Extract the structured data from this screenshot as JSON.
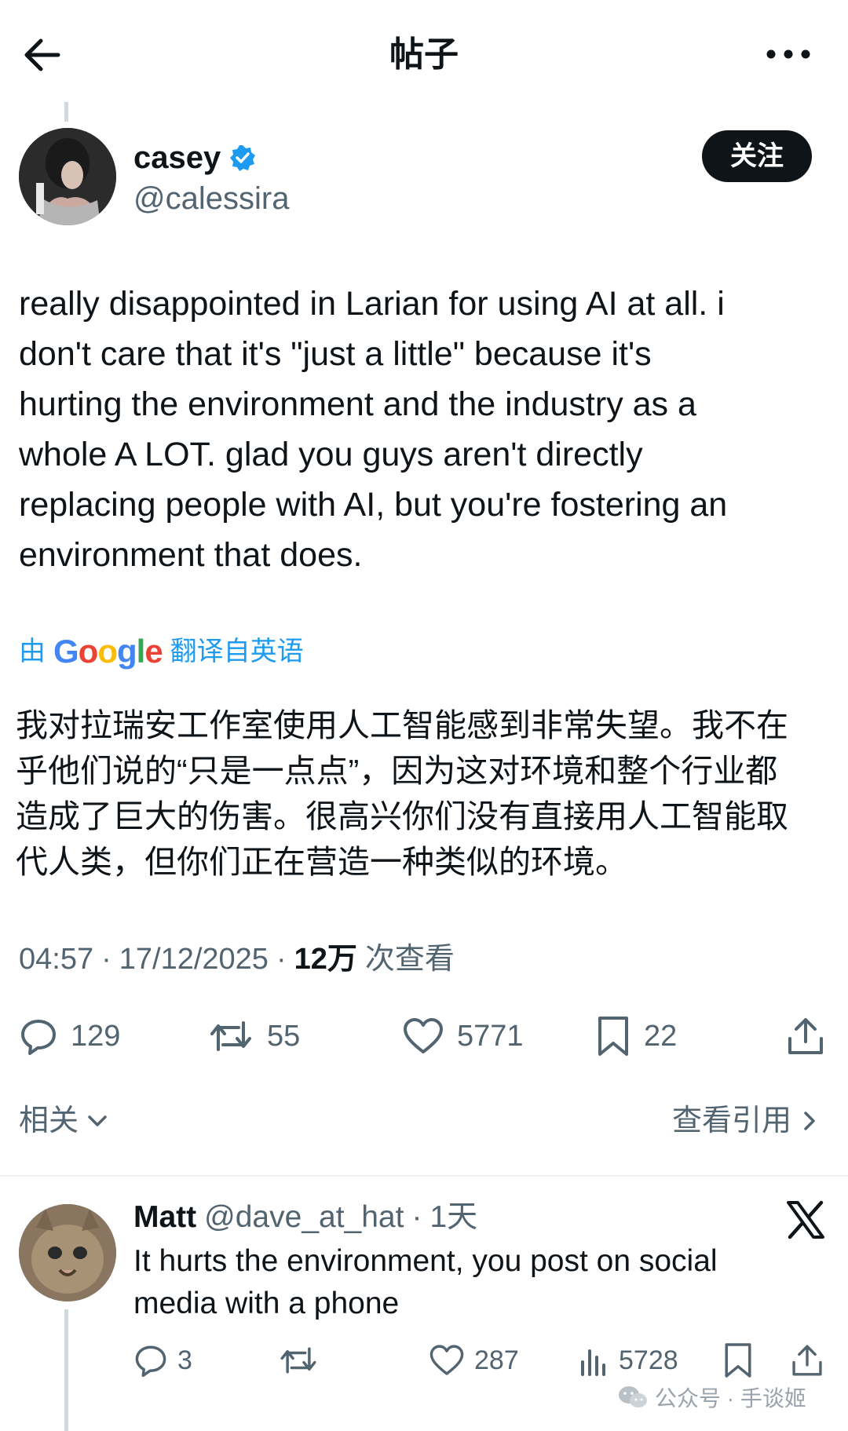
{
  "header": {
    "title": "帖子"
  },
  "author": {
    "name": "casey",
    "handle": "@calessira",
    "follow_label": "关注"
  },
  "post": {
    "lines": [
      "really disappointed in Larian for using AI at all. i",
      "don't care that it's \"just a little\" because it's",
      "hurting the environment and the industry as a",
      "whole A LOT. glad you guys aren't directly",
      "replacing people with AI, but you're fostering an",
      "environment that does."
    ],
    "translate_prefix": "由",
    "translate_brand": "Google",
    "translate_suffix": "翻译自英语",
    "translation_lines": [
      "我对拉瑞安工作室使用人工智能感到非常失望。我不在",
      "乎他们说的“只是一点点”，因为这对环境和整个行业都",
      "造成了巨大的伤害。很高兴你们没有直接用人工智能取",
      "代人类，但你们正在营造一种类似的环境。"
    ],
    "time": "04:57",
    "date": "17/12/2025",
    "views_count": "12万",
    "views_label": "次查看",
    "replies": "129",
    "reposts": "55",
    "likes": "5771",
    "bookmarks": "22"
  },
  "related_label": "相关",
  "quotes_label": "查看引用",
  "reply": {
    "name": "Matt",
    "handle": "@dave_at_hat",
    "time": "1天",
    "lines": [
      "It hurts the environment, you post on social",
      "media with a phone"
    ],
    "replies": "3",
    "likes": "287",
    "views": "5728"
  },
  "watermark": "公众号 · 手谈姬",
  "colors": {
    "accent": "#1d9bf0",
    "text": "#0f1419",
    "muted": "#536471"
  }
}
